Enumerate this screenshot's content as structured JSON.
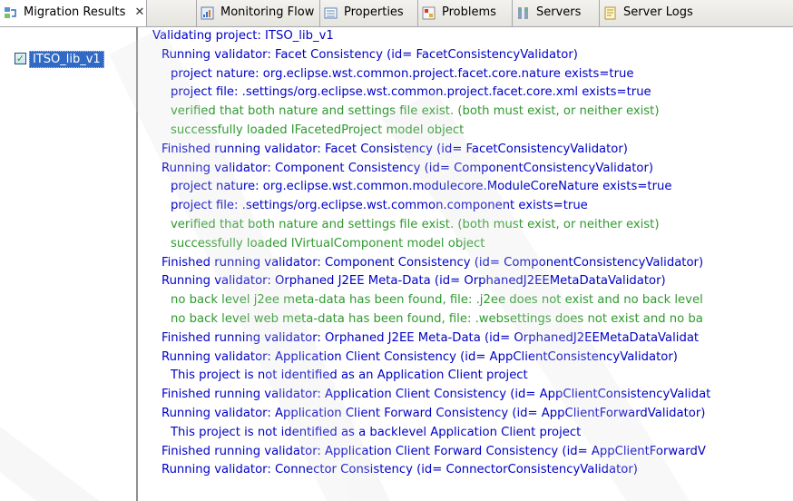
{
  "tabs": [
    {
      "label": "Migration Results",
      "icon": "migration-results-icon",
      "close": "✕",
      "active": true
    },
    {
      "label": "Monitoring Flow",
      "icon": "monitoring-flow-icon"
    },
    {
      "label": "Properties",
      "icon": "properties-icon"
    },
    {
      "label": "Problems",
      "icon": "problems-icon"
    },
    {
      "label": "Servers",
      "icon": "servers-icon"
    },
    {
      "label": "Server Logs",
      "icon": "server-logs-icon"
    }
  ],
  "tree": {
    "items": [
      {
        "label": "ITSO_lib_v1",
        "checked": true
      }
    ]
  },
  "log": {
    "lines": [
      "Validating project: ITSO_lib_v1",
      "Running validator: Facet Consistency (id= FacetConsistencyValidator)",
      "project nature: org.eclipse.wst.common.project.facet.core.nature exists=true",
      "project file: .settings/org.eclipse.wst.common.project.facet.core.xml exists=true",
      "verified that both nature and settings file exist.  (both must exist, or neither exist)",
      "successfully loaded IFacetedProject model object",
      "Finished running validator: Facet Consistency (id= FacetConsistencyValidator)",
      "Running validator: Component Consistency (id= ComponentConsistencyValidator)",
      "project nature: org.eclipse.wst.common.modulecore.ModuleCoreNature exists=true",
      "project file: .settings/org.eclipse.wst.common.component exists=true",
      "verified that both nature and settings file exist.  (both must exist, or neither exist)",
      "successfully loaded IVirtualComponent model object",
      "Finished running validator: Component Consistency (id= ComponentConsistencyValidator)",
      "Running validator: Orphaned J2EE Meta-Data (id= OrphanedJ2EEMetaDataValidator)",
      "no back level j2ee meta-data has been found, file: .j2ee does not exist and no back level",
      "no back level web meta-data has been found, file: .websettings does not exist and no ba",
      "Finished running validator: Orphaned J2EE Meta-Data (id= OrphanedJ2EEMetaDataValidat",
      "Running validator: Application Client Consistency (id= AppClientConsistencyValidator)",
      "This project is not identified as an Application Client project",
      "Finished running validator: Application Client Consistency (id= AppClientConsistencyValidat",
      "Running validator: Application Client Forward Consistency (id= AppClientForwardValidator)",
      "This project is not identified as a backlevel Application Client project",
      "Finished running validator: Application Client Forward Consistency (id= AppClientForwardV",
      "Running validator: Connector Consistency (id= ConnectorConsistencyValidator)"
    ]
  },
  "colors": {
    "log_blue": "#0000c8",
    "log_green": "#2f9a2f",
    "selection": "#316ac5"
  }
}
